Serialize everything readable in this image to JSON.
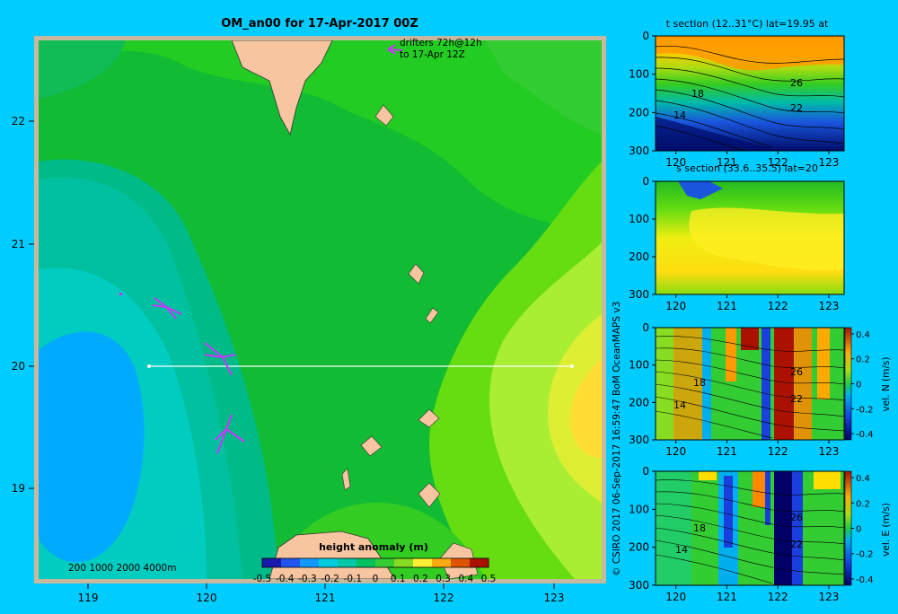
{
  "colors": {
    "background": "#00ccff",
    "land": "#f7c59f",
    "drifter": "#cc33ff",
    "section_line": "#ffffff"
  },
  "main_map": {
    "title": "OM_an00 for 17-Apr-2017 00Z",
    "drifter_label_line1": "drifters 72h@12h",
    "drifter_label_line2": "to 17-Apr 12Z",
    "x_ticks": [
      "119",
      "120",
      "121",
      "122",
      "123"
    ],
    "y_ticks": [
      "22",
      "21",
      "20",
      "19"
    ],
    "depth_legend": "200  1000  2000  4000m",
    "colorbar_title": "height anomaly (m)",
    "colorbar_ticks": [
      "-0.5",
      "-0.4",
      "-0.3",
      "-0.2",
      "-0.1",
      "0",
      "0.1",
      "0.2",
      "0.3",
      "0.4",
      "0.5"
    ],
    "colorbar_colors": [
      "#1a1aaa",
      "#2255ee",
      "#1199ff",
      "#00ccdd",
      "#00c8a8",
      "#00c060",
      "#33cc33",
      "#88dd22",
      "#ffee33",
      "#ffaa11",
      "#dd5500",
      "#aa1100"
    ]
  },
  "credit": "© CSIRO 2017   06-Sep-2017 16:59:47 BoM OceanMAPS v3",
  "sections": [
    {
      "title": "t section (12..31°C) lat=19.95 at",
      "x_ticks": [
        "120",
        "121",
        "122",
        "123"
      ],
      "y_ticks": [
        "0",
        "100",
        "200",
        "300"
      ],
      "contour_labels": [
        "26",
        "22",
        "18",
        "14"
      ],
      "has_colorbar": false,
      "colorbar_label": "",
      "colorbar_ticks": []
    },
    {
      "title": "s section (33.6..35.5) lat=20",
      "x_ticks": [
        "120",
        "121",
        "122",
        "123"
      ],
      "y_ticks": [
        "0",
        "100",
        "200",
        "300"
      ],
      "contour_labels": [],
      "has_colorbar": false,
      "colorbar_label": "",
      "colorbar_ticks": []
    },
    {
      "title": "",
      "x_ticks": [
        "120",
        "121",
        "122",
        "123"
      ],
      "y_ticks": [
        "0",
        "100",
        "200",
        "300"
      ],
      "contour_labels": [
        "26",
        "22",
        "18",
        "14"
      ],
      "has_colorbar": true,
      "colorbar_label": "vel. N (m/s)",
      "colorbar_ticks": [
        "0.4",
        "0.2",
        "0",
        "-0.2",
        "-0.4"
      ]
    },
    {
      "title": "",
      "x_ticks": [
        "120",
        "121",
        "122",
        "123"
      ],
      "y_ticks": [
        "0",
        "100",
        "200",
        "300"
      ],
      "contour_labels": [
        "26",
        "22",
        "18",
        "14"
      ],
      "has_colorbar": true,
      "colorbar_label": "vel. E (m/s)",
      "colorbar_ticks": [
        "0.4",
        "0.2",
        "0",
        "-0.2",
        "-0.4"
      ]
    }
  ],
  "chart_data": [
    {
      "type": "heatmap",
      "title": "OM_an00 for 17-Apr-2017 00Z",
      "variable": "height anomaly (m)",
      "xlim": [
        118.55,
        123.5
      ],
      "ylim": [
        18.25,
        22.7
      ],
      "colorbar_range": [
        -0.5,
        0.5
      ],
      "section_line": {
        "lon": [
          119.5,
          123.2
        ],
        "lat": [
          20.0,
          20.0
        ]
      },
      "features": [
        {
          "name": "low anomaly (blue)",
          "lon": 119.15,
          "lat": 19.95,
          "approx_value": -0.25
        },
        {
          "name": "high anomaly (yellow)",
          "lon": 123.35,
          "lat": 19.85,
          "approx_value": 0.2
        }
      ],
      "drifters": [
        {
          "lon": 119.12,
          "lat": 20.48
        },
        {
          "lon": 119.98,
          "lat": 20.1
        },
        {
          "lon": 120.2,
          "lat": 19.45
        },
        {
          "lon": 122.0,
          "lat": 22.62
        }
      ]
    },
    {
      "type": "heatmap",
      "title": "t section (12..31°C) lat=19.95 at",
      "xlim": [
        119.6,
        123.3
      ],
      "ylim": [
        300,
        0
      ],
      "value_range": [
        12,
        31
      ],
      "contour_values": [
        14,
        18,
        22,
        26
      ]
    },
    {
      "type": "heatmap",
      "title": "s section (33.6..35.5) lat=20",
      "xlim": [
        119.6,
        123.3
      ],
      "ylim": [
        300,
        0
      ],
      "value_range": [
        33.6,
        35.5
      ]
    },
    {
      "type": "heatmap",
      "variable": "vel. N (m/s)",
      "xlim": [
        119.6,
        123.3
      ],
      "ylim": [
        300,
        0
      ],
      "value_range": [
        -0.4,
        0.4
      ]
    },
    {
      "type": "heatmap",
      "variable": "vel. E (m/s)",
      "xlim": [
        119.6,
        123.3
      ],
      "ylim": [
        300,
        0
      ],
      "value_range": [
        -0.4,
        0.4
      ]
    }
  ]
}
